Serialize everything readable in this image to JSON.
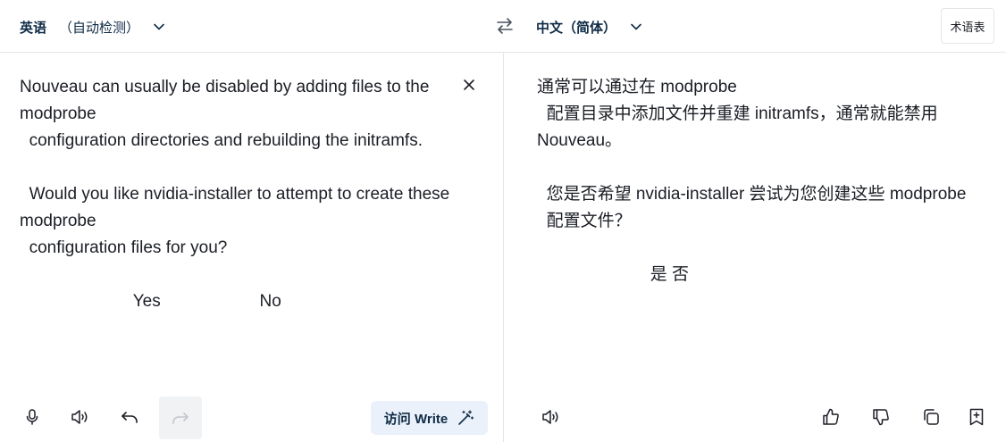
{
  "header": {
    "source_lang": "英语",
    "source_detect": "（自动检测）",
    "target_lang": "中文（简体）",
    "glossary_label": "术语表"
  },
  "source": {
    "text": "Nouveau can usually be disabled by adding files to the modprobe\n  configuration directories and rebuilding the initramfs.\n\n  Would you like nvidia-installer to attempt to create these modprobe\n  configuration files for you?\n\n                        Yes                     No"
  },
  "target": {
    "text": "通常可以通过在 modprobe\n  配置目录中添加文件并重建 initramfs，通常就能禁用 Nouveau。\n\n  您是否希望 nvidia-installer 尝试为您创建这些 modprobe\n  配置文件？\n\n                        是 否"
  },
  "toolbar": {
    "write_label": "访问 Write"
  },
  "icons": {
    "source_lang_chevron": "chevron-down-icon",
    "swap": "swap-icon",
    "target_lang_chevron": "chevron-down-icon",
    "clear": "close-icon",
    "microphone": "microphone-icon",
    "listen_source": "speaker-icon",
    "undo": "undo-icon",
    "redo": "redo-icon",
    "magic_wand": "magic-wand-icon",
    "listen_target": "speaker-icon",
    "thumbs_up": "thumbs-up-icon",
    "thumbs_down": "thumbs-down-icon",
    "copy": "copy-icon",
    "save": "bookmark-add-icon"
  },
  "colors": {
    "brand_dark": "#0f2b46",
    "write_bg": "#eaf1fb",
    "border": "#e3e5e9",
    "text": "#1b1e25"
  }
}
